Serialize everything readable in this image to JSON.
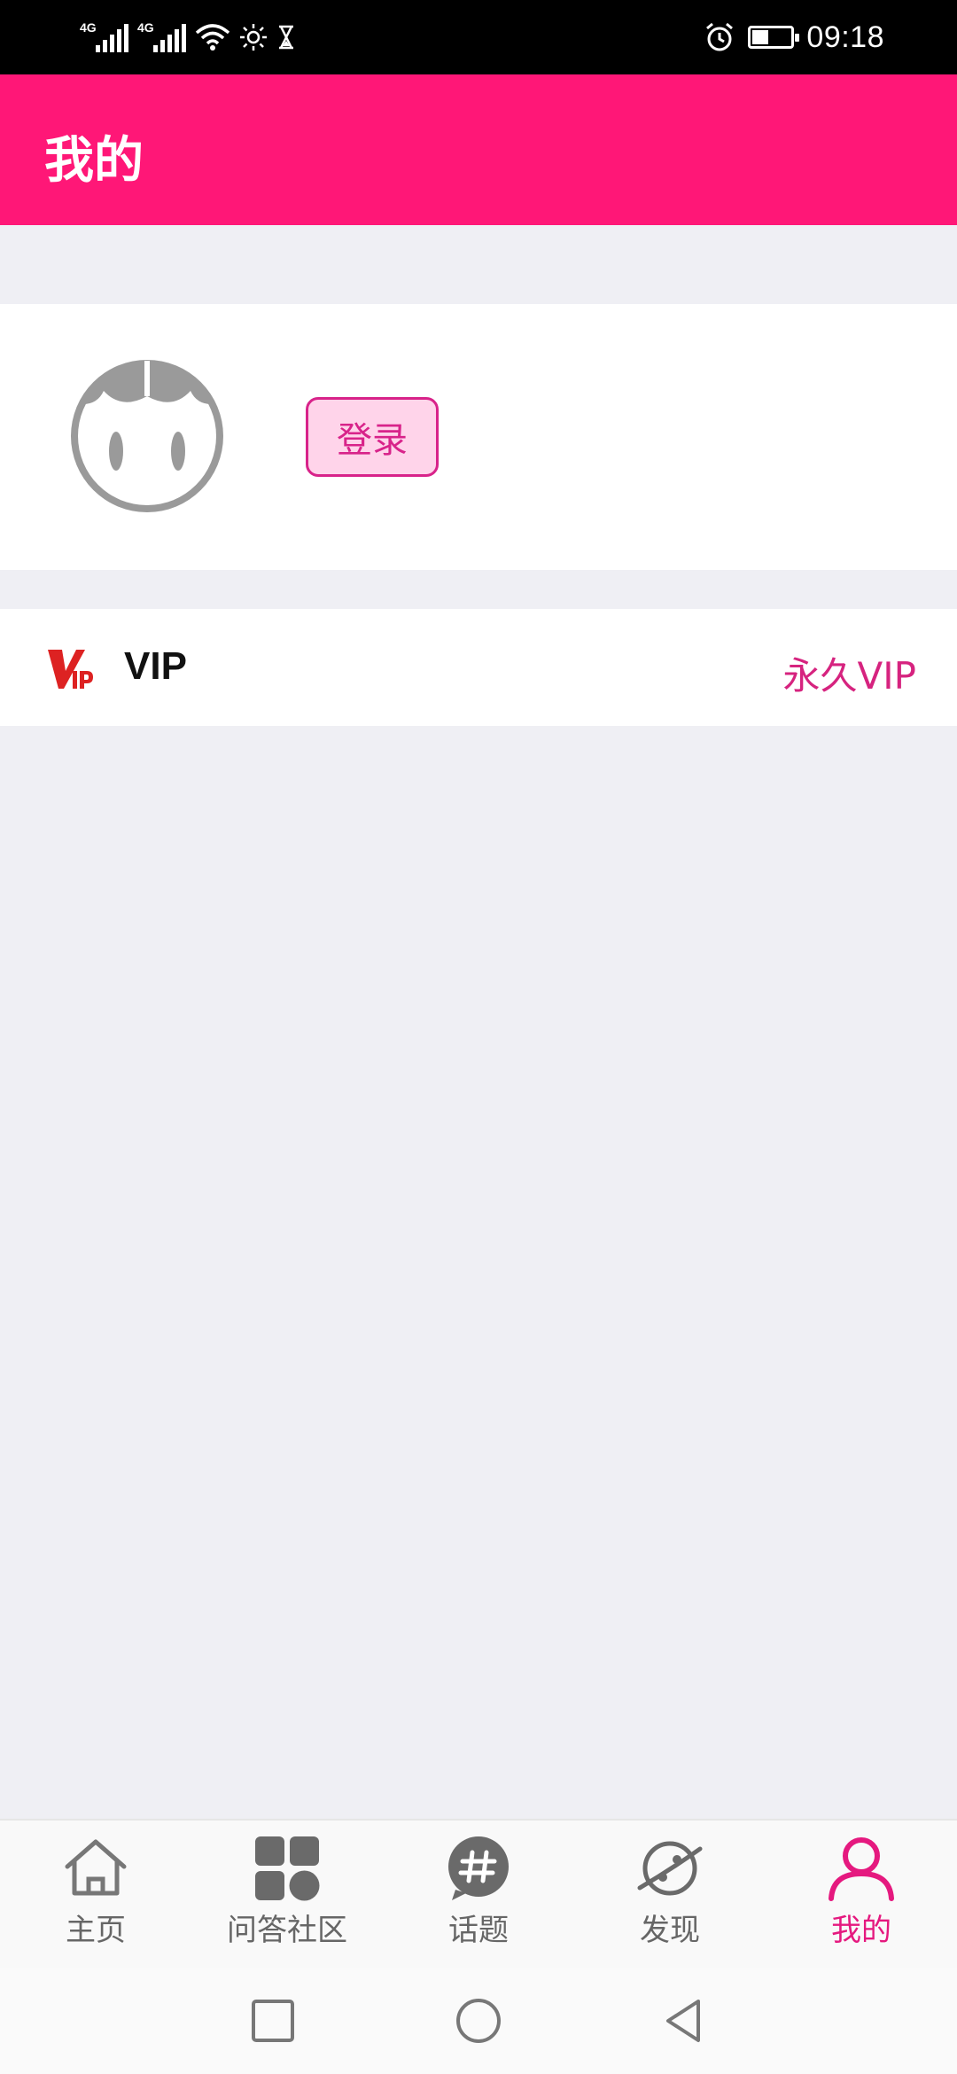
{
  "status_bar": {
    "signal1_label": "4G",
    "signal2_label": "4G",
    "time": "09:18"
  },
  "header": {
    "title": "我的"
  },
  "profile": {
    "login_label": "登录"
  },
  "vip": {
    "label": "VIP",
    "value": "永久VIP"
  },
  "bottom_nav": {
    "items": [
      {
        "label": "主页",
        "icon": "home-icon"
      },
      {
        "label": "问答社区",
        "icon": "grid-icon"
      },
      {
        "label": "话题",
        "icon": "hashtag-icon"
      },
      {
        "label": "发现",
        "icon": "discover-icon"
      },
      {
        "label": "我的",
        "icon": "person-icon",
        "active": true
      }
    ]
  },
  "colors": {
    "brand": "#ff1777",
    "accent_text": "#d6237f",
    "background": "#efeff4"
  }
}
